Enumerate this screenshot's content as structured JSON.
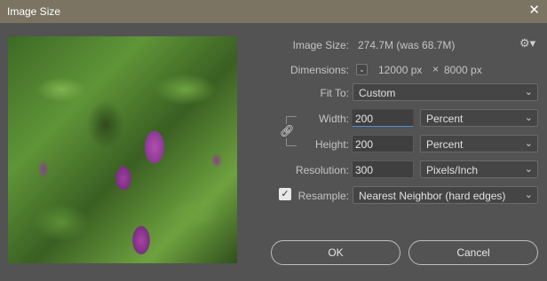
{
  "window": {
    "title": "Image Size",
    "close_glyph": "✕"
  },
  "image_size": {
    "label": "Image Size:",
    "value": "274.7M (was 68.7M)"
  },
  "dimensions": {
    "label": "Dimensions:",
    "width_value": "12000 px",
    "separator": "×",
    "height_value": "8000 px"
  },
  "fit_to": {
    "label": "Fit To:",
    "value": "Custom"
  },
  "width": {
    "label": "Width:",
    "value": "200",
    "unit": "Percent"
  },
  "height": {
    "label": "Height:",
    "value": "200",
    "unit": "Percent"
  },
  "resolution": {
    "label": "Resolution:",
    "value": "300",
    "unit": "Pixels/Inch"
  },
  "resample": {
    "label": "Resample:",
    "checked": true,
    "value": "Nearest Neighbor (hard edges)"
  },
  "buttons": {
    "ok": "OK",
    "cancel": "Cancel"
  },
  "icons": {
    "gear": "gear-icon",
    "chain": "link-icon",
    "chevron": "chevron-down-icon",
    "check": "checkmark-icon"
  },
  "colors": {
    "titlebar": "#7b7462",
    "background": "#535353",
    "focus_underline": "#4a8fd8"
  }
}
